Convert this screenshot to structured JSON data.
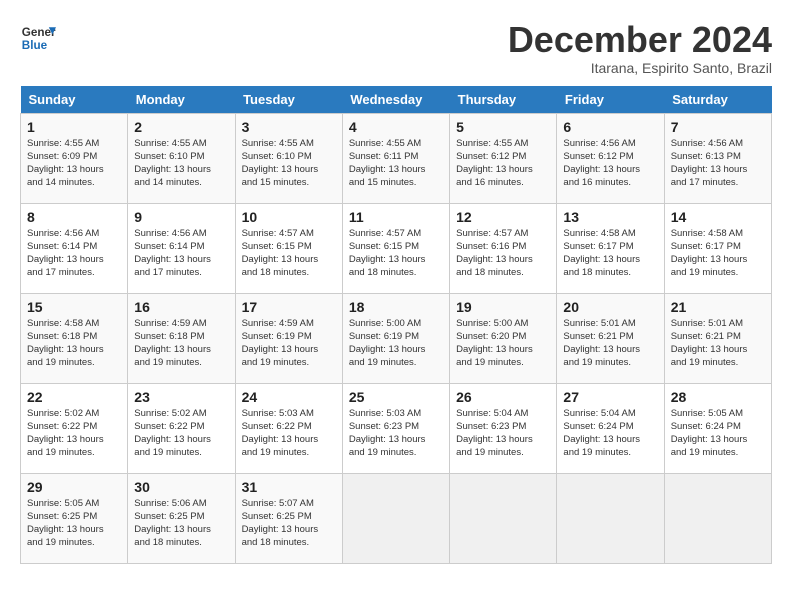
{
  "header": {
    "logo_line1": "General",
    "logo_line2": "Blue",
    "month_title": "December 2024",
    "location": "Itarana, Espirito Santo, Brazil"
  },
  "days_of_week": [
    "Sunday",
    "Monday",
    "Tuesday",
    "Wednesday",
    "Thursday",
    "Friday",
    "Saturday"
  ],
  "weeks": [
    [
      {
        "day": "1",
        "info": "Sunrise: 4:55 AM\nSunset: 6:09 PM\nDaylight: 13 hours\nand 14 minutes."
      },
      {
        "day": "2",
        "info": "Sunrise: 4:55 AM\nSunset: 6:10 PM\nDaylight: 13 hours\nand 14 minutes."
      },
      {
        "day": "3",
        "info": "Sunrise: 4:55 AM\nSunset: 6:10 PM\nDaylight: 13 hours\nand 15 minutes."
      },
      {
        "day": "4",
        "info": "Sunrise: 4:55 AM\nSunset: 6:11 PM\nDaylight: 13 hours\nand 15 minutes."
      },
      {
        "day": "5",
        "info": "Sunrise: 4:55 AM\nSunset: 6:12 PM\nDaylight: 13 hours\nand 16 minutes."
      },
      {
        "day": "6",
        "info": "Sunrise: 4:56 AM\nSunset: 6:12 PM\nDaylight: 13 hours\nand 16 minutes."
      },
      {
        "day": "7",
        "info": "Sunrise: 4:56 AM\nSunset: 6:13 PM\nDaylight: 13 hours\nand 17 minutes."
      }
    ],
    [
      {
        "day": "8",
        "info": "Sunrise: 4:56 AM\nSunset: 6:14 PM\nDaylight: 13 hours\nand 17 minutes."
      },
      {
        "day": "9",
        "info": "Sunrise: 4:56 AM\nSunset: 6:14 PM\nDaylight: 13 hours\nand 17 minutes."
      },
      {
        "day": "10",
        "info": "Sunrise: 4:57 AM\nSunset: 6:15 PM\nDaylight: 13 hours\nand 18 minutes."
      },
      {
        "day": "11",
        "info": "Sunrise: 4:57 AM\nSunset: 6:15 PM\nDaylight: 13 hours\nand 18 minutes."
      },
      {
        "day": "12",
        "info": "Sunrise: 4:57 AM\nSunset: 6:16 PM\nDaylight: 13 hours\nand 18 minutes."
      },
      {
        "day": "13",
        "info": "Sunrise: 4:58 AM\nSunset: 6:17 PM\nDaylight: 13 hours\nand 18 minutes."
      },
      {
        "day": "14",
        "info": "Sunrise: 4:58 AM\nSunset: 6:17 PM\nDaylight: 13 hours\nand 19 minutes."
      }
    ],
    [
      {
        "day": "15",
        "info": "Sunrise: 4:58 AM\nSunset: 6:18 PM\nDaylight: 13 hours\nand 19 minutes."
      },
      {
        "day": "16",
        "info": "Sunrise: 4:59 AM\nSunset: 6:18 PM\nDaylight: 13 hours\nand 19 minutes."
      },
      {
        "day": "17",
        "info": "Sunrise: 4:59 AM\nSunset: 6:19 PM\nDaylight: 13 hours\nand 19 minutes."
      },
      {
        "day": "18",
        "info": "Sunrise: 5:00 AM\nSunset: 6:19 PM\nDaylight: 13 hours\nand 19 minutes."
      },
      {
        "day": "19",
        "info": "Sunrise: 5:00 AM\nSunset: 6:20 PM\nDaylight: 13 hours\nand 19 minutes."
      },
      {
        "day": "20",
        "info": "Sunrise: 5:01 AM\nSunset: 6:21 PM\nDaylight: 13 hours\nand 19 minutes."
      },
      {
        "day": "21",
        "info": "Sunrise: 5:01 AM\nSunset: 6:21 PM\nDaylight: 13 hours\nand 19 minutes."
      }
    ],
    [
      {
        "day": "22",
        "info": "Sunrise: 5:02 AM\nSunset: 6:22 PM\nDaylight: 13 hours\nand 19 minutes."
      },
      {
        "day": "23",
        "info": "Sunrise: 5:02 AM\nSunset: 6:22 PM\nDaylight: 13 hours\nand 19 minutes."
      },
      {
        "day": "24",
        "info": "Sunrise: 5:03 AM\nSunset: 6:22 PM\nDaylight: 13 hours\nand 19 minutes."
      },
      {
        "day": "25",
        "info": "Sunrise: 5:03 AM\nSunset: 6:23 PM\nDaylight: 13 hours\nand 19 minutes."
      },
      {
        "day": "26",
        "info": "Sunrise: 5:04 AM\nSunset: 6:23 PM\nDaylight: 13 hours\nand 19 minutes."
      },
      {
        "day": "27",
        "info": "Sunrise: 5:04 AM\nSunset: 6:24 PM\nDaylight: 13 hours\nand 19 minutes."
      },
      {
        "day": "28",
        "info": "Sunrise: 5:05 AM\nSunset: 6:24 PM\nDaylight: 13 hours\nand 19 minutes."
      }
    ],
    [
      {
        "day": "29",
        "info": "Sunrise: 5:05 AM\nSunset: 6:25 PM\nDaylight: 13 hours\nand 19 minutes."
      },
      {
        "day": "30",
        "info": "Sunrise: 5:06 AM\nSunset: 6:25 PM\nDaylight: 13 hours\nand 18 minutes."
      },
      {
        "day": "31",
        "info": "Sunrise: 5:07 AM\nSunset: 6:25 PM\nDaylight: 13 hours\nand 18 minutes."
      },
      {
        "day": "",
        "info": ""
      },
      {
        "day": "",
        "info": ""
      },
      {
        "day": "",
        "info": ""
      },
      {
        "day": "",
        "info": ""
      }
    ]
  ]
}
